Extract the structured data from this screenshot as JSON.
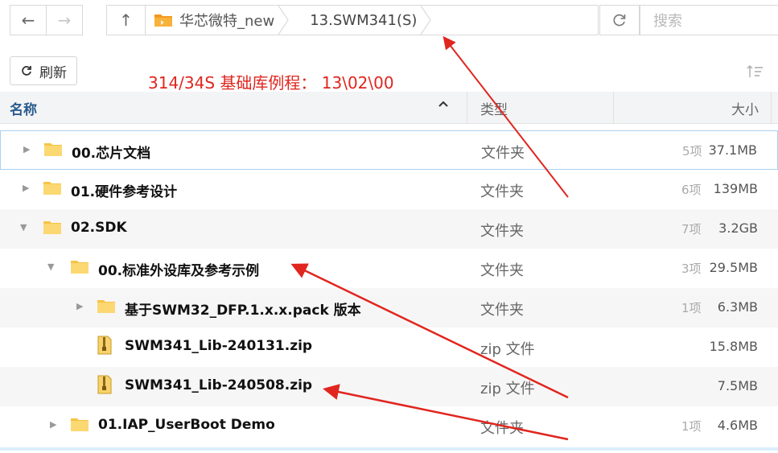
{
  "toolbar": {
    "back_icon": "←",
    "forward_icon": "→",
    "up_icon": "↑",
    "breadcrumb": [
      "华芯微特_new",
      "13.SWM341(S)"
    ],
    "reload_icon": "reload-icon",
    "search_placeholder": "搜索",
    "refresh_label": "刷新",
    "sort_icon": "sort-icon"
  },
  "annotation": {
    "text": "314/34S 基础库例程：  13\\02\\00",
    "color": "#e0261f"
  },
  "columns": {
    "name": "名称",
    "type": "类型",
    "size": "大小"
  },
  "rows": [
    {
      "name": "00.芯片文档",
      "type": "文件夹",
      "count": "5项",
      "size": "37.1MB",
      "kind": "folder",
      "expand": "collapsed"
    },
    {
      "name": "01.硬件参考设计",
      "type": "文件夹",
      "count": "6项",
      "size": "139MB",
      "kind": "folder",
      "expand": "collapsed"
    },
    {
      "name": "02.SDK",
      "type": "文件夹",
      "count": "7项",
      "size": "3.2GB",
      "kind": "folder",
      "expand": "expanded"
    },
    {
      "name": "00.标准外设库及参考示例",
      "type": "文件夹",
      "count": "3项",
      "size": "29.5MB",
      "kind": "folder",
      "expand": "expanded"
    },
    {
      "name": "基于SWM32_DFP.1.x.x.pack 版本",
      "type": "文件夹",
      "count": "1项",
      "size": "6.3MB",
      "kind": "folder",
      "expand": "collapsed"
    },
    {
      "name": "SWM341_Lib-240131.zip",
      "type": "zip 文件",
      "count": "",
      "size": "15.8MB",
      "kind": "zip",
      "expand": "none"
    },
    {
      "name": "SWM341_Lib-240508.zip",
      "type": "zip 文件",
      "count": "",
      "size": "7.5MB",
      "kind": "zip",
      "expand": "none"
    },
    {
      "name": "01.IAP_UserBoot Demo",
      "type": "文件夹",
      "count": "1项",
      "size": "4.6MB",
      "kind": "folder",
      "expand": "collapsed"
    }
  ],
  "colors": {
    "accent": "#2a5d8e",
    "folder": "#f6c445",
    "selection_border": "#a9d1f2"
  }
}
